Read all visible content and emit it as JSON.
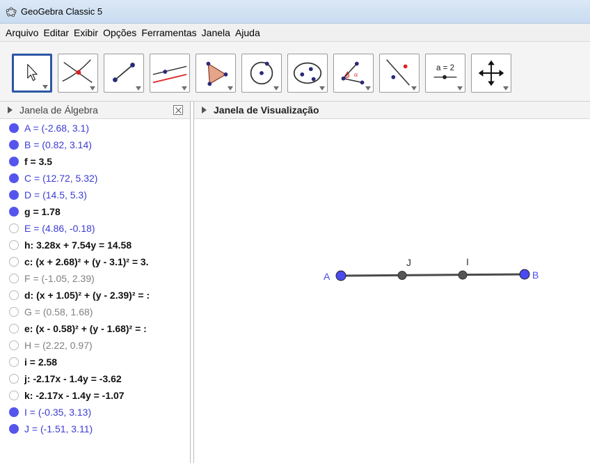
{
  "window": {
    "title": "GeoGebra Classic 5"
  },
  "menu": [
    "Arquivo",
    "Editar",
    "Exibir",
    "Opções",
    "Ferramentas",
    "Janela",
    "Ajuda"
  ],
  "toolbar": {
    "tools": [
      {
        "name": "move-tool",
        "icon": "cursor-arrow-icon",
        "selected": true
      },
      {
        "name": "point-tool",
        "icon": "intersection-point-icon"
      },
      {
        "name": "line-tool",
        "icon": "segment-icon"
      },
      {
        "name": "parallel-tool",
        "icon": "parallel-lines-icon"
      },
      {
        "name": "polygon-tool",
        "icon": "polygon-icon"
      },
      {
        "name": "circle-tool",
        "icon": "circle-center-point-icon"
      },
      {
        "name": "conic-tool",
        "icon": "ellipse-icon"
      },
      {
        "name": "angle-tool",
        "icon": "angle-icon"
      },
      {
        "name": "reflect-tool",
        "icon": "reflect-line-icon"
      },
      {
        "name": "slider-tool",
        "icon": "slider-icon",
        "label": "a = 2"
      },
      {
        "name": "move-view-tool",
        "icon": "move-graphics-view-icon"
      }
    ]
  },
  "algebra_view": {
    "title": "Janela de Álgebra",
    "items": [
      {
        "text": "A = (-2.68, 3.1)",
        "visible": true,
        "style": "point"
      },
      {
        "text": "B = (0.82, 3.14)",
        "visible": true,
        "style": "point"
      },
      {
        "text": "f = 3.5",
        "visible": true,
        "style": "bold"
      },
      {
        "text": "C = (12.72, 5.32)",
        "visible": true,
        "style": "point"
      },
      {
        "text": "D = (14.5, 5.3)",
        "visible": true,
        "style": "point"
      },
      {
        "text": "g = 1.78",
        "visible": true,
        "style": "bold"
      },
      {
        "text": "E = (4.86, -0.18)",
        "visible": false,
        "style": "point"
      },
      {
        "text": "h: 3.28x + 7.54y = 14.58",
        "visible": false,
        "style": "bold"
      },
      {
        "text": "c: (x + 2.68)² + (y - 3.1)² = 3.",
        "visible": false,
        "style": "bold"
      },
      {
        "text": "F = (-1.05, 2.39)",
        "visible": false,
        "style": "hidden-point"
      },
      {
        "text": "d: (x + 1.05)² + (y - 2.39)² = :",
        "visible": false,
        "style": "bold"
      },
      {
        "text": "G = (0.58, 1.68)",
        "visible": false,
        "style": "hidden-point"
      },
      {
        "text": "e: (x - 0.58)² + (y - 1.68)² = :",
        "visible": false,
        "style": "bold"
      },
      {
        "text": "H = (2.22, 0.97)",
        "visible": false,
        "style": "hidden-point"
      },
      {
        "text": "i = 2.58",
        "visible": false,
        "style": "bold"
      },
      {
        "text": "j: -2.17x - 1.4y = -3.62",
        "visible": false,
        "style": "bold"
      },
      {
        "text": "k: -2.17x - 1.4y = -1.07",
        "visible": false,
        "style": "bold"
      },
      {
        "text": "I = (-0.35, 3.13)",
        "visible": true,
        "style": "point"
      },
      {
        "text": "J = (-1.51, 3.11)",
        "visible": true,
        "style": "point"
      }
    ]
  },
  "graphics_view": {
    "title": "Janela de Visualização",
    "labels": {
      "A": "A",
      "B": "B",
      "I": "I",
      "J": "J"
    },
    "colors": {
      "free_point": "#4a4af0",
      "dependent_point": "#555555",
      "segment": "#4a4a4a"
    }
  }
}
